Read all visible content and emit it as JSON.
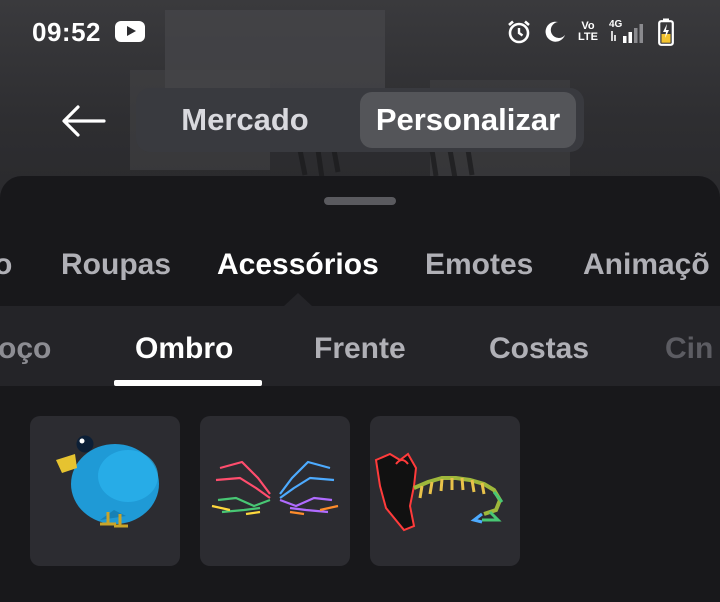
{
  "status_bar": {
    "time": "09:52",
    "icons": [
      "youtube-icon",
      "alarm-icon",
      "moon-icon",
      "volte-icon",
      "signal-icon",
      "battery-icon"
    ],
    "volte_text": [
      "Vo",
      "LTE"
    ],
    "network_text": "4G"
  },
  "top_nav": {
    "back_icon": "back-arrow-icon",
    "tabs": [
      {
        "label": "Mercado",
        "selected": false
      },
      {
        "label": "Personalizar",
        "selected": true
      }
    ]
  },
  "categories": [
    {
      "label": "o",
      "active": false
    },
    {
      "label": "Roupas",
      "active": false
    },
    {
      "label": "Acessórios",
      "active": true
    },
    {
      "label": "Emotes",
      "active": false
    },
    {
      "label": "Animaçõ",
      "active": false
    }
  ],
  "subcategories": [
    {
      "label": "oço",
      "active": false
    },
    {
      "label": "Ombro",
      "active": true
    },
    {
      "label": "Frente",
      "active": false
    },
    {
      "label": "Costas",
      "active": false
    },
    {
      "label": "Cin",
      "active": false
    }
  ],
  "items": [
    {
      "icon": "blue-bird-icon"
    },
    {
      "icon": "neon-wings-icon"
    },
    {
      "icon": "shoulder-dragon-icon"
    }
  ],
  "colors": {
    "sheet_bg": "#18181b",
    "subrow_bg": "#242428",
    "tile_bg": "#2c2c31",
    "selected_tab_bg": "#545559"
  }
}
